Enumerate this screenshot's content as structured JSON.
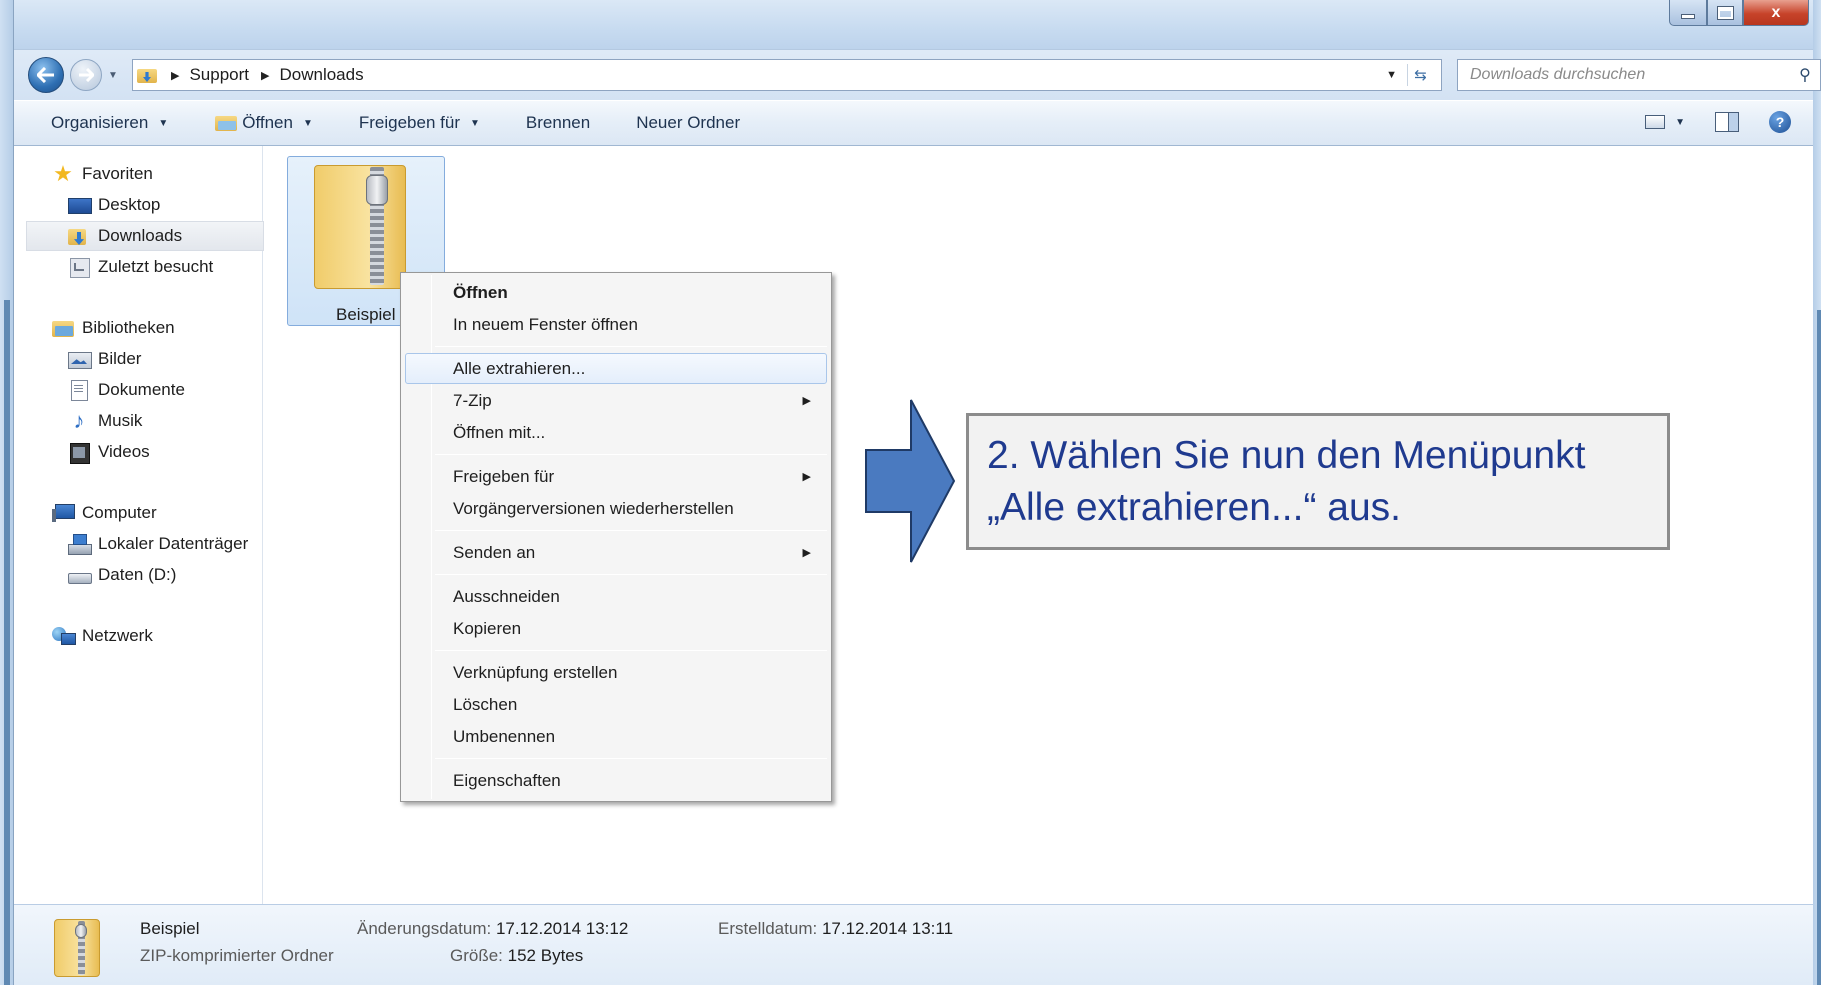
{
  "window": {
    "controls": {
      "minimize": "–",
      "maximize": "□",
      "close": "x"
    }
  },
  "address": {
    "crumbs": [
      "Support",
      "Downloads"
    ],
    "search_placeholder": "Downloads durchsuchen"
  },
  "toolbar": {
    "organize": "Organisieren",
    "open": "Öffnen",
    "share": "Freigeben für",
    "burn": "Brennen",
    "new_folder": "Neuer Ordner"
  },
  "nav": {
    "favorites": "Favoriten",
    "desktop": "Desktop",
    "downloads": "Downloads",
    "recent": "Zuletzt besucht",
    "libraries": "Bibliotheken",
    "pictures": "Bilder",
    "documents": "Dokumente",
    "music": "Musik",
    "videos": "Videos",
    "computer": "Computer",
    "local_disk": "Lokaler Datenträger",
    "data_drive": "Daten (D:)",
    "network": "Netzwerk"
  },
  "file": {
    "name": "Beispiel"
  },
  "context_menu": {
    "open": "Öffnen",
    "open_new_window": "In neuem Fenster öffnen",
    "extract_all": "Alle extrahieren...",
    "seven_zip": "7-Zip",
    "open_with": "Öffnen mit...",
    "share": "Freigeben für",
    "restore_previous": "Vorgängerversionen wiederherstellen",
    "send_to": "Senden an",
    "cut": "Ausschneiden",
    "copy": "Kopieren",
    "create_shortcut": "Verknüpfung erstellen",
    "delete": "Löschen",
    "rename": "Umbenennen",
    "properties": "Eigenschaften"
  },
  "callout": {
    "text": "2. Wählen Sie nun den Menüpunkt\n„Alle extrahieren...“ aus.",
    "color": "#1f3a8f",
    "arrow_color": "#4a7ac0"
  },
  "details": {
    "name": "Beispiel",
    "type": "ZIP-komprimierter Ordner",
    "modified_label": "Änderungsdatum:",
    "modified_value": "17.12.2014 13:12",
    "size_label": "Größe:",
    "size_value": "152 Bytes",
    "created_label": "Erstelldatum:",
    "created_value": "17.12.2014 13:11"
  }
}
